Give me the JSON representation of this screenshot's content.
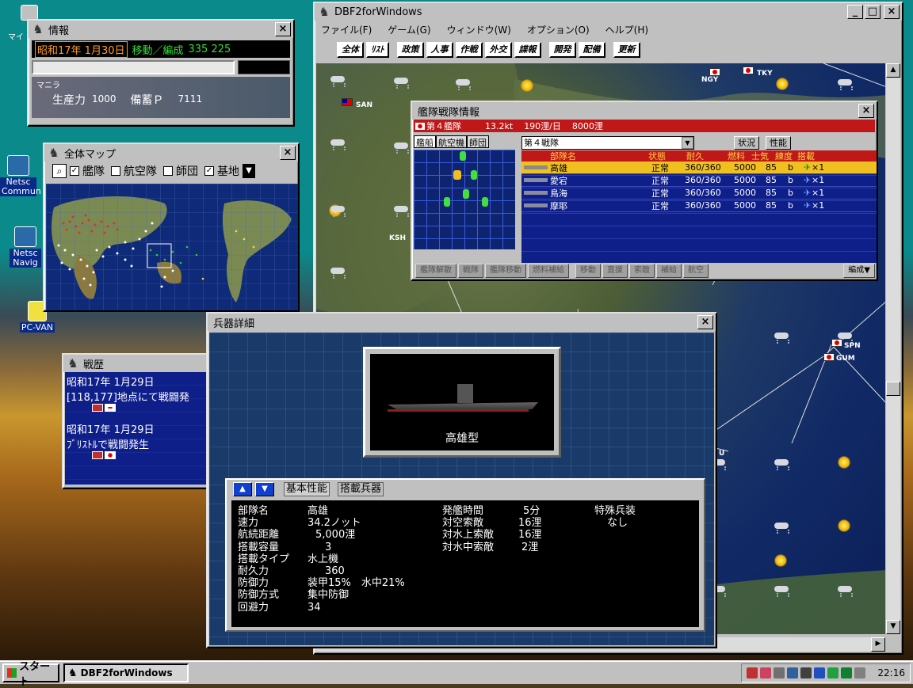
{
  "desktop": {
    "icons": [
      {
        "label": "マイ",
        "top": true
      },
      {
        "label": "Netsc\nCommun"
      },
      {
        "label": "Netsc\nNavig"
      },
      {
        "label": "PC-VAN"
      }
    ]
  },
  "info_window": {
    "title": "情報",
    "date": "昭和17年 1月30日",
    "mode": "移動／編成",
    "coords": "335 225",
    "location": "マニラ",
    "production_label": "生産力",
    "production_value": "1000",
    "reserve_label": "備蓄Ｐ",
    "reserve_value": "7111"
  },
  "minimap_window": {
    "title": "全体マップ",
    "filters": [
      {
        "label": "艦隊",
        "checked": true
      },
      {
        "label": "航空隊",
        "checked": false
      },
      {
        "label": "師団",
        "checked": false
      },
      {
        "label": "基地",
        "checked": true
      }
    ]
  },
  "history_window": {
    "title": "戦歴",
    "entries": [
      {
        "date": "昭和17年 1月29日",
        "text": "[118,177]地点にて戦闘発"
      },
      {
        "date": "昭和17年 1月29日",
        "text": "ﾌﾞﾘｽﾄﾙで戦闘発生"
      }
    ]
  },
  "main_window": {
    "title": "DBF2forWindows",
    "menu": [
      "ファイル(F)",
      "ゲーム(G)",
      "ウィンドウ(W)",
      "オプション(O)",
      "ヘルプ(H)"
    ],
    "toolbar": [
      "全体",
      "ﾘｽﾄ",
      "政策",
      "人事",
      "作戦",
      "外交",
      "諜報",
      "開発",
      "配備",
      "更新"
    ],
    "map_labels": [
      "NGY",
      "TKY",
      "SAN",
      "KSH",
      "SPN",
      "GUM",
      "U"
    ]
  },
  "fleet_window": {
    "title": "艦隊戦隊情報",
    "fleet_name": "第４艦隊",
    "tonnage": "13.2kt",
    "speed": "190浬/日",
    "range": "8000浬",
    "tabs": [
      "艦船",
      "航空機",
      "師団"
    ],
    "squadron_select": "第４戦隊",
    "buttons": [
      "状況",
      "性能"
    ],
    "columns": [
      "部隊名",
      "状態",
      "耐久",
      "燃料",
      "士気",
      "練度",
      "搭載"
    ],
    "ships": [
      {
        "name": "高雄",
        "status": "正常",
        "durability": "360/360",
        "fuel": "5000",
        "morale": "85",
        "skill": "b",
        "load": "×1",
        "selected": true
      },
      {
        "name": "愛宕",
        "status": "正常",
        "durability": "360/360",
        "fuel": "5000",
        "morale": "85",
        "skill": "b",
        "load": "×1"
      },
      {
        "name": "鳥海",
        "status": "正常",
        "durability": "360/360",
        "fuel": "5000",
        "morale": "85",
        "skill": "b",
        "load": "×1"
      },
      {
        "name": "摩耶",
        "status": "正常",
        "durability": "360/360",
        "fuel": "5000",
        "morale": "85",
        "skill": "b",
        "load": "×1"
      }
    ],
    "bottom_buttons": [
      "艦隊解散",
      "戦隊",
      "艦隊移動",
      "燃料補給",
      "移動",
      "直援",
      "索敵",
      "補給",
      "航空",
      "編成▼"
    ]
  },
  "weapon_window": {
    "title": "兵器詳細",
    "ship_class": "高雄型",
    "tabs": [
      "基本性能",
      "搭載兵器"
    ],
    "stats_left": [
      {
        "label": "部隊名",
        "value": "高雄"
      },
      {
        "label": "速力",
        "value": "34.2ノット"
      },
      {
        "label": "航続距離",
        "value": "5,000浬"
      },
      {
        "label": "搭載容量",
        "value": "3"
      },
      {
        "label": "搭載タイプ",
        "value": "水上機"
      },
      {
        "label": "耐久力",
        "value": "360"
      },
      {
        "label": "防御力",
        "value": "装甲15%　水中21%"
      },
      {
        "label": "防御方式",
        "value": "集中防御"
      },
      {
        "label": "回避力",
        "value": "34"
      }
    ],
    "stats_mid": [
      {
        "label": "発艦時間",
        "value": "5分"
      },
      {
        "label": "対空索敵",
        "value": "16浬"
      },
      {
        "label": "対水上索敵",
        "value": "16浬"
      },
      {
        "label": "対水中索敵",
        "value": "2浬"
      }
    ],
    "special_label": "特殊兵装",
    "special_value": "なし"
  },
  "taskbar": {
    "start": "スタート",
    "task": "DBF2forWindows",
    "clock": "22:16"
  }
}
